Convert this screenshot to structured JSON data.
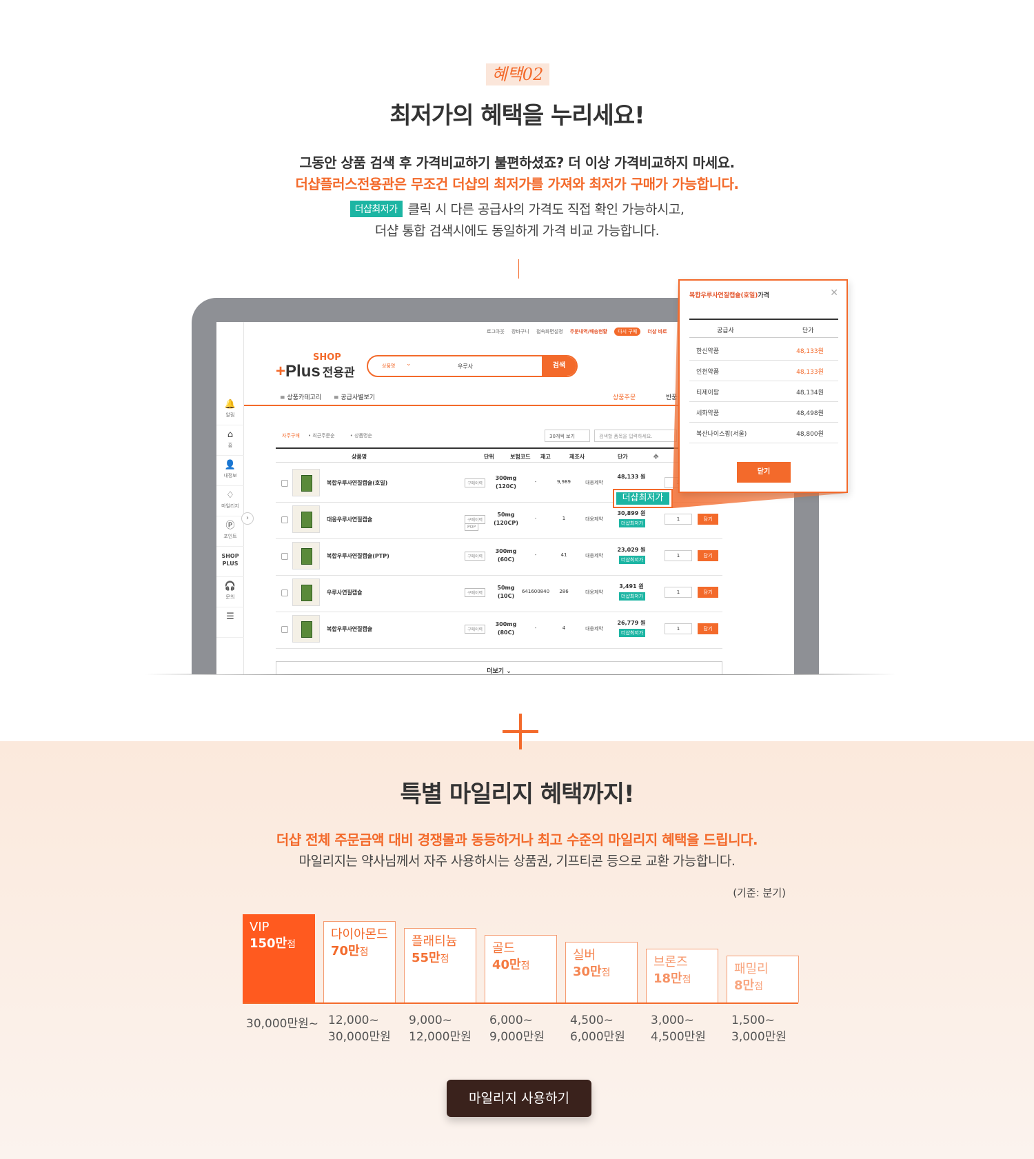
{
  "section1": {
    "badge": "혜택02",
    "title": "최저가의 혜택을 누리세요!",
    "desc_line1": "그동안 상품 검색 후 가격비교하기 불편하셨죠? 더 이상 가격비교하지 마세요.",
    "desc_line2": "더샵플러스전용관은 무조건 더샵의 최저가를 가져와 최저가 구매가 가능합니다.",
    "desc_tag": "더샵최저가",
    "desc_line3": "클릭 시 다른 공급사의 가격도 직접 확인 가능하시고,",
    "desc_line4": "더샵 통합 검색시에도 동일하게 가격 비교 가능합니다."
  },
  "mock": {
    "sidebar": [
      {
        "icon": "bell-icon",
        "glyph": "🔔",
        "label": "알림"
      },
      {
        "icon": "home-icon",
        "glyph": "⌂",
        "label": "홈"
      },
      {
        "icon": "user-icon",
        "glyph": "👤",
        "label": "내정보"
      },
      {
        "icon": "diamond-icon",
        "glyph": "♢",
        "label": "마일리지"
      },
      {
        "icon": "point-icon",
        "glyph": "Ⓟ",
        "label": "포인트"
      },
      {
        "icon": "shopplus-icon",
        "glyph": "SHOP",
        "label": "PLUS"
      },
      {
        "icon": "headset-icon",
        "glyph": "🎧",
        "label": "문의"
      },
      {
        "icon": "menu-icon",
        "glyph": "☰",
        "label": ""
      }
    ],
    "util_links": [
      "로그아웃",
      "장바구니",
      "접속화면설정"
    ],
    "util_order": "주문내역/배송현황",
    "util_rebuy": "다시 구매",
    "util_extra": "더샵 바로",
    "logo_top": "SHOP",
    "logo_main": "Plus",
    "logo_kr": "전용관",
    "search_select": "상품명",
    "search_query": "우루사",
    "search_button": "검색",
    "gnb_category": "≡ 상품카테고리",
    "gnb_supplier": "≡ 공급사별보기",
    "gnb_order": "상품주문",
    "gnb_return": "반품신",
    "tabs": [
      "자주구매",
      "최근주문순",
      "상품명순"
    ],
    "view_count": "30개씩 보기",
    "filter_placeholder": "검색할 품목을 입력하세요.",
    "headers": {
      "name": "상품명",
      "unit": "단위",
      "ins": "보험코드",
      "stock": "재고",
      "mfr": "제조사",
      "price": "단가",
      "qty": "수"
    },
    "rows": [
      {
        "name": "복합우루사연질캡슐(호일)",
        "pill": "구매이력",
        "pill2": "",
        "unit1": "300mg",
        "unit2": "(120C)",
        "ins": "-",
        "stock": "9,989",
        "mfr": "대웅제약",
        "price": "48,133 원",
        "tag": "",
        "qty": "1",
        "add": "담기"
      },
      {
        "name": "대웅우루사연질캡슐",
        "pill": "구매이력",
        "pill2": "POP",
        "unit1": "50mg",
        "unit2": "(120CP)",
        "ins": "-",
        "stock": "1",
        "mfr": "대웅제약",
        "price": "30,899 원",
        "tag": "더샵최저가",
        "qty": "1",
        "add": "담기"
      },
      {
        "name": "복합우루사연질캡슐(PTP)",
        "pill": "구매이력",
        "pill2": "",
        "unit1": "300mg",
        "unit2": "(60C)",
        "ins": "-",
        "stock": "41",
        "mfr": "대웅제약",
        "price": "23,029 원",
        "tag": "더샵최저가",
        "qty": "1",
        "add": "담기"
      },
      {
        "name": "우루사연질캡슐",
        "pill": "구매이력",
        "pill2": "",
        "unit1": "50mg",
        "unit2": "(10C)",
        "ins": "641600840",
        "stock": "286",
        "mfr": "대웅제약",
        "price": "3,491 원",
        "tag": "더샵최저가",
        "qty": "1",
        "add": "담기"
      },
      {
        "name": "복합우루사연질캡슐",
        "pill": "구매이력",
        "pill2": "",
        "unit1": "300mg",
        "unit2": "(80C)",
        "ins": "-",
        "stock": "4",
        "mfr": "대웅제약",
        "price": "26,779 원",
        "tag": "더샵최저가",
        "qty": "1",
        "add": "담기"
      }
    ],
    "more": "더보기 ⌄",
    "callout_tag": "더샵최저가"
  },
  "popup": {
    "title_product": "복합우루사연질캡슐(호일)",
    "title_suffix": "가격",
    "col_supplier": "공급사",
    "col_price": "단가",
    "rows": [
      {
        "supplier": "한신약품",
        "price": "48,133원",
        "highlight": true
      },
      {
        "supplier": "인천약품",
        "price": "48,133원",
        "highlight": true
      },
      {
        "supplier": "티제이팜",
        "price": "48,134원",
        "highlight": false
      },
      {
        "supplier": "세화약품",
        "price": "48,498원",
        "highlight": false
      },
      {
        "supplier": "복산나이스팜(서울)",
        "price": "48,800원",
        "highlight": false
      }
    ],
    "close_label": "닫기"
  },
  "section2": {
    "title": "특별 마일리지 혜택까지!",
    "desc_line1": "더샵 전체 주문금액 대비 경쟁몰과 동등하거나 최고 수준의 마일리지 혜택을 드립니다.",
    "desc_line2": "마일리지는 약사님께서 자주 사용하시는 상품권, 기프티콘 등으로 교환 가능합니다.",
    "basis": "(기준: 분기)",
    "tiers": [
      {
        "name": "VIP",
        "points": "150만",
        "unit": "점",
        "range1": "30,000만원~",
        "range2": ""
      },
      {
        "name": "다이아몬드",
        "points": "70만",
        "unit": "점",
        "range1": "12,000~",
        "range2": "30,000만원"
      },
      {
        "name": "플래티늄",
        "points": "55만",
        "unit": "점",
        "range1": "9,000~",
        "range2": "12,000만원"
      },
      {
        "name": "골드",
        "points": "40만",
        "unit": "점",
        "range1": "6,000~",
        "range2": "9,000만원"
      },
      {
        "name": "실버",
        "points": "30만",
        "unit": "점",
        "range1": "4,500~",
        "range2": "6,000만원"
      },
      {
        "name": "브론즈",
        "points": "18만",
        "unit": "점",
        "range1": "3,000~",
        "range2": "4,500만원"
      },
      {
        "name": "패밀리",
        "points": "8만",
        "unit": "점",
        "range1": "1,500~",
        "range2": "3,000만원"
      }
    ],
    "cta": "마일리지 사용하기"
  },
  "colors": {
    "accent": "#f36a2b",
    "teal": "#1cb5a3",
    "cta_bg": "#3a221c"
  }
}
